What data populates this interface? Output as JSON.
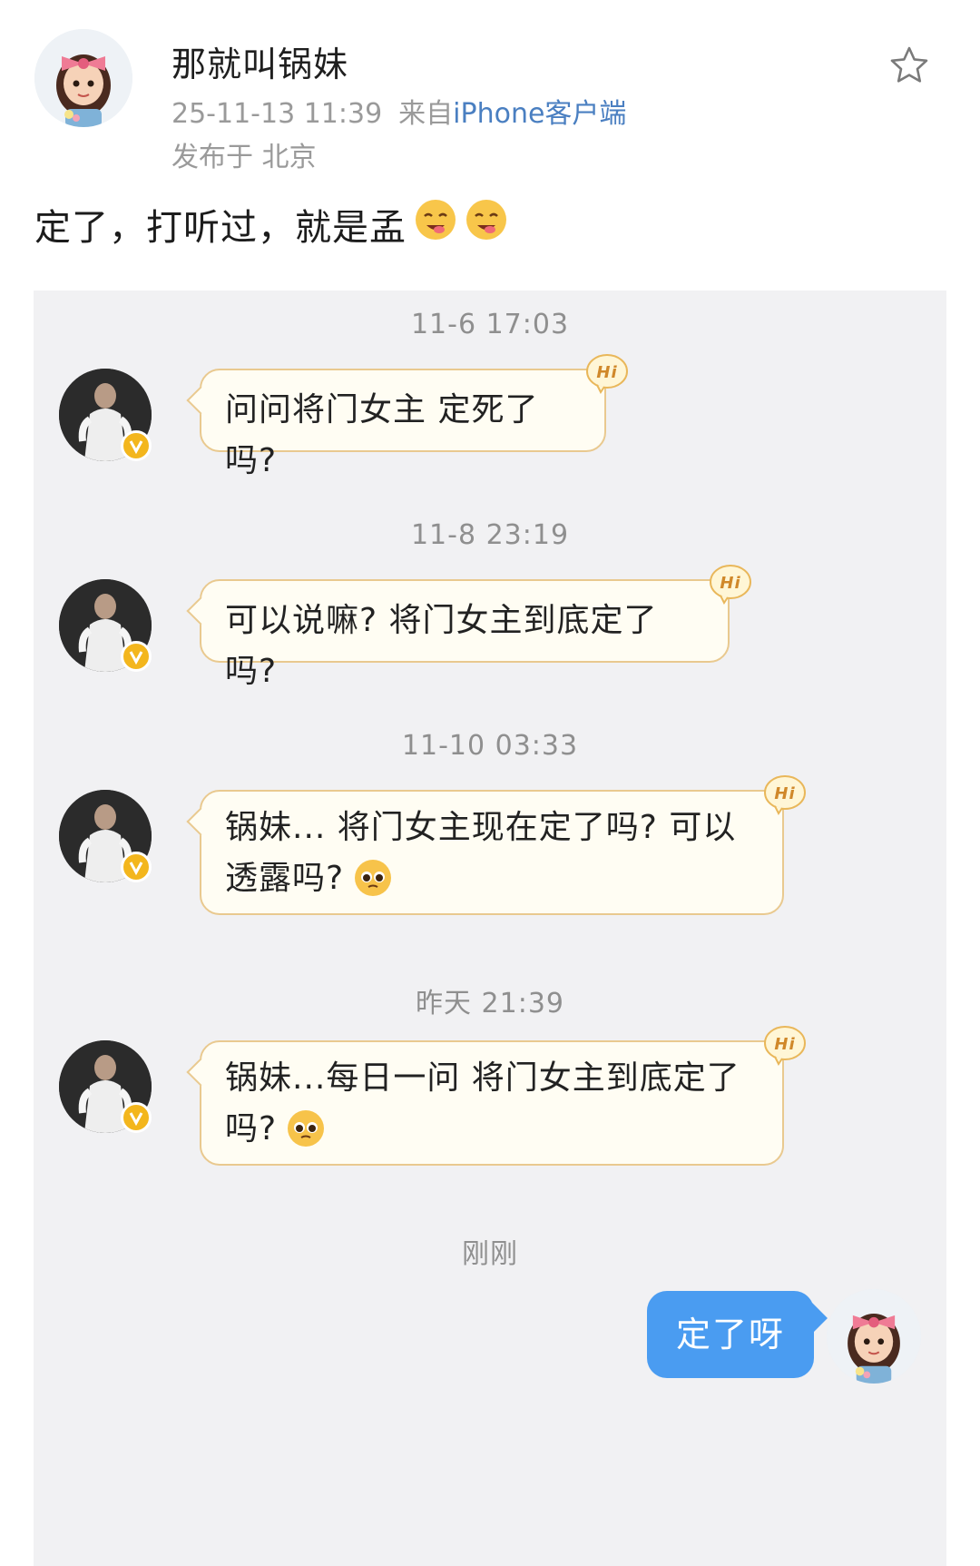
{
  "post": {
    "author": "那就叫锅妹",
    "timestamp": "25-11-13 11:39",
    "source_prefix": "来自",
    "source_client": "iPhone客户端",
    "location": "发布于 北京",
    "text": "定了，打听过，就是孟",
    "text_emojis": [
      "yummy-face-emoji",
      "yummy-face-emoji"
    ]
  },
  "chat": {
    "messages": [
      {
        "time": "11-6 17:03",
        "text": "问问将门女主 定死了吗?",
        "emoji": ""
      },
      {
        "time": "11-8 23:19",
        "text": "可以说嘛? 将门女主到底定了吗?",
        "emoji": ""
      },
      {
        "time": "11-10 03:33",
        "text": "锅妹... 将门女主现在定了吗? 可以透露吗?",
        "emoji": "pleading-face-emoji"
      },
      {
        "time": "昨天 21:39",
        "text": "锅妹...每日一问 将门女主到底定了吗?",
        "emoji": "pleading-face-emoji"
      }
    ],
    "reply": {
      "time": "刚刚",
      "text": "定了呀"
    },
    "hi_badge_text": "Hi",
    "colors": {
      "reply_bubble": "#4a9cf1",
      "incoming_bubble": "#fffdf3",
      "incoming_border": "#e9c98f",
      "verified_badge": "#f3b61d"
    }
  }
}
